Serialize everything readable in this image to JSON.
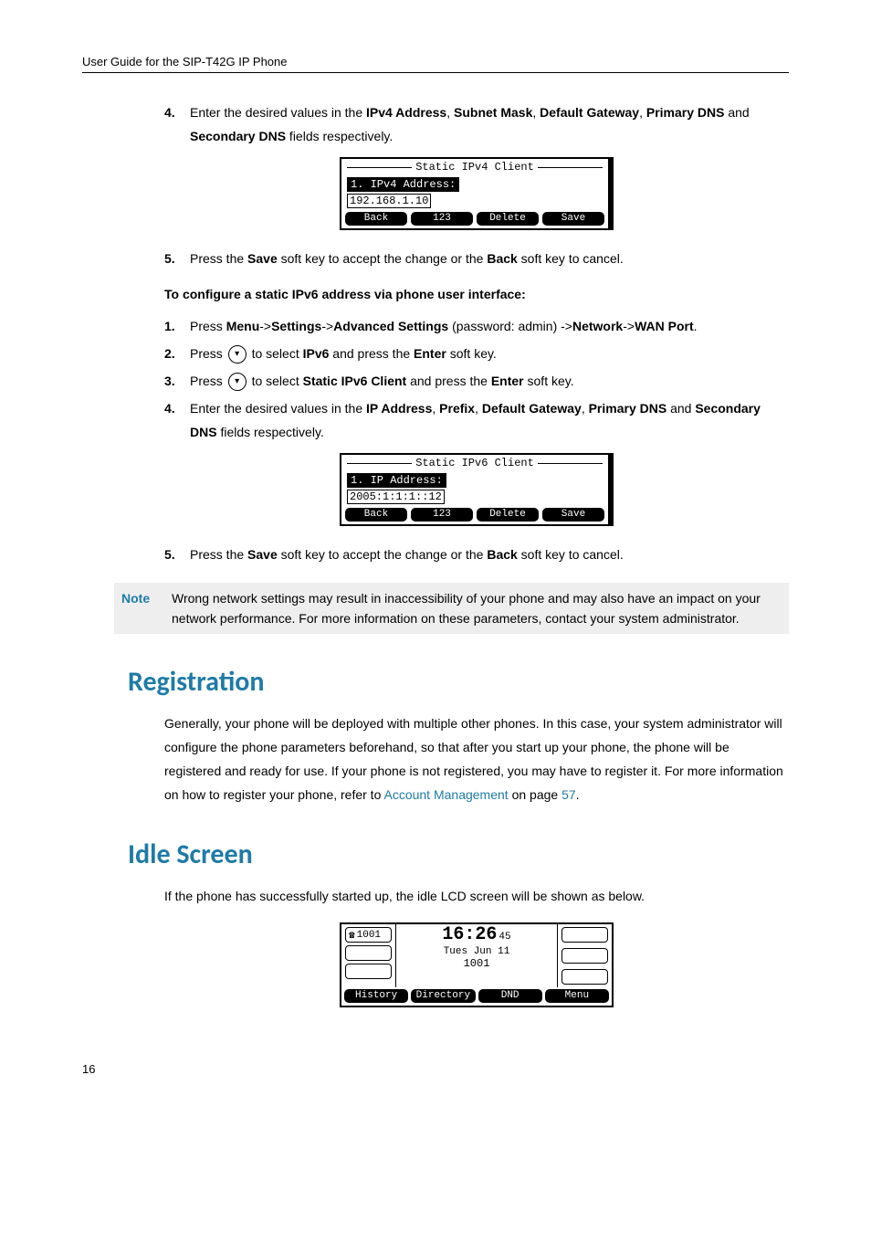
{
  "header": "User Guide for the SIP-T42G IP Phone",
  "footer_page": "16",
  "sectionA": {
    "step4": {
      "num": "4.",
      "before": "Enter the desired values in the ",
      "fields_a": "IPv4 Address",
      "sep1": ", ",
      "fields_b": "Subnet Mask",
      "sep2": ", ",
      "fields_c": "Default Gateway",
      "sep3": ", ",
      "fields_d": "Primary DNS",
      "and": " and ",
      "fields_e": "Secondary DNS",
      "after": " fields respectively."
    },
    "lcd": {
      "title": "Static IPv4 Client",
      "label": "1. IPv4 Address:",
      "value": "192.168.1.10",
      "sk1": "Back",
      "sk2": "123",
      "sk3": "Delete",
      "sk4": "Save"
    },
    "step5": {
      "num": "5.",
      "t1": "Press the ",
      "b1": "Save",
      "t2": " soft key to accept the change or the ",
      "b2": "Back",
      "t3": " soft key to cancel."
    }
  },
  "sectionB": {
    "heading": "To configure a static IPv6 address via phone user interface:",
    "step1": {
      "num": "1.",
      "t1": "Press ",
      "p1": "Menu",
      "a1": "->",
      "p2": "Settings",
      "a2": "->",
      "p3": "Advanced Settings",
      "paren": " (password: admin) ->",
      "p4": "Network",
      "a4": "->",
      "p5": "WAN Port",
      "end": "."
    },
    "step2": {
      "num": "2.",
      "t1": "Press ",
      "t2": " to select ",
      "b1": "IPv6",
      "t3": " and press the ",
      "b2": "Enter",
      "t4": " soft key."
    },
    "step3": {
      "num": "3.",
      "t1": "Press ",
      "t2": " to select ",
      "b1": "Static IPv6 Client",
      "t3": " and press the ",
      "b2": "Enter",
      "t4": " soft key."
    },
    "step4": {
      "num": "4.",
      "t1": "Enter the desired values in the ",
      "f1": "IP Address",
      "s1": ", ",
      "f2": "Prefix",
      "s2": ", ",
      "f3": "Default Gateway",
      "s3": ", ",
      "f4": "Primary DNS",
      "and": " and ",
      "f5": "Secondary DNS",
      "t2": " fields respectively."
    },
    "lcd": {
      "title": "Static IPv6 Client",
      "label": "1. IP Address:",
      "value": "2005:1:1:1::12",
      "sk1": "Back",
      "sk2": "123",
      "sk3": "Delete",
      "sk4": "Save"
    },
    "step5": {
      "num": "5.",
      "t1": "Press the ",
      "b1": "Save",
      "t2": " soft key to accept the change or the ",
      "b2": "Back",
      "t3": " soft key to cancel."
    }
  },
  "note": {
    "label": "Note",
    "text": "Wrong network settings may result in inaccessibility of your phone and may also have an impact on your network performance. For more information on these parameters, contact your system administrator."
  },
  "registration": {
    "heading": "Registration",
    "p1": "Generally, your phone will be deployed with multiple other phones. In this case, your system administrator will configure the phone parameters beforehand, so that after you start up your phone, the phone will be registered and ready for use. If your phone is not registered, you may have to register it. For more information on how to register your phone, refer to ",
    "link1": "Account Management",
    "p2": " on page ",
    "link2": "57",
    "p3": "."
  },
  "idle": {
    "heading": "Idle Screen",
    "intro": "If the phone has successfully started up, the idle LCD screen will be shown as below.",
    "line1": "1001",
    "time_main": "16:26",
    "time_sec": "45",
    "date": "Tues Jun 11",
    "ext": "1001",
    "sk1": "History",
    "sk2": "Directory",
    "sk3": "DND",
    "sk4": "Menu"
  }
}
